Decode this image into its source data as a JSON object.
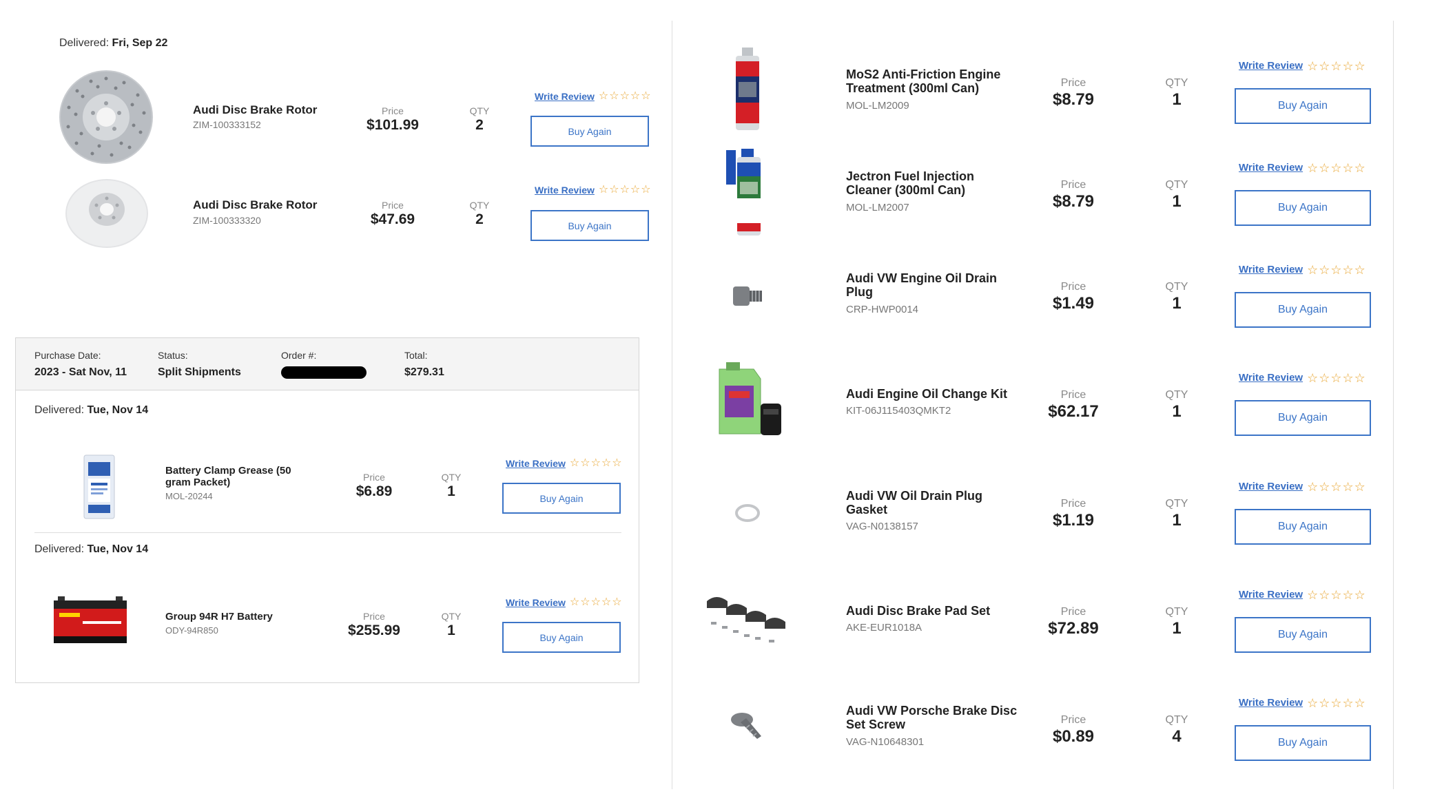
{
  "top_left": {
    "delivered_label": "Delivered:",
    "delivered_date": "Fri, Sep 22",
    "items": [
      {
        "name": "Audi Disc Brake Rotor",
        "sku": "ZIM-100333152",
        "price_label": "Price",
        "price": "$101.99",
        "qty_label": "QTY",
        "qty": "2",
        "review_label": "Write Review",
        "buy_label": "Buy Again",
        "image": "drilled-brake-rotor"
      },
      {
        "name": "Audi Disc Brake Rotor",
        "sku": "ZIM-100333320",
        "price_label": "Price",
        "price": "$47.69",
        "qty_label": "QTY",
        "qty": "2",
        "review_label": "Write Review",
        "buy_label": "Buy Again",
        "image": "solid-brake-rotor"
      }
    ]
  },
  "order": {
    "purchase_date_label": "Purchase Date:",
    "purchase_date": "2023 - Sat Nov, 11",
    "status_label": "Status:",
    "status": "Split Shipments",
    "order_label": "Order #:",
    "total_label": "Total:",
    "total": "$279.31",
    "shipments": [
      {
        "delivered_label": "Delivered:",
        "delivered_date": "Tue, Nov 14",
        "item": {
          "name": "Battery Clamp Grease (50 gram Packet)",
          "sku": "MOL-20244",
          "price_label": "Price",
          "price": "$6.89",
          "qty_label": "QTY",
          "qty": "1",
          "review_label": "Write Review",
          "buy_label": "Buy Again",
          "image": "grease-packet"
        }
      },
      {
        "delivered_label": "Delivered:",
        "delivered_date": "Tue, Nov 14",
        "item": {
          "name": "Group 94R H7 Battery",
          "sku": "ODY-94R850",
          "price_label": "Price",
          "price": "$255.99",
          "qty_label": "QTY",
          "qty": "1",
          "review_label": "Write Review",
          "buy_label": "Buy Again",
          "image": "car-battery"
        }
      }
    ]
  },
  "right": {
    "items": [
      {
        "name": "MoS2 Anti-Friction Engine Treatment (300ml Can)",
        "sku": "MOL-LM2009",
        "price_label": "Price",
        "price": "$8.79",
        "qty_label": "QTY",
        "qty": "1",
        "review_label": "Write Review",
        "buy_label": "Buy Again",
        "image": "additive-can"
      },
      {
        "name": "Jectron Fuel Injection Cleaner (300ml Can)",
        "sku": "MOL-LM2007",
        "price_label": "Price",
        "price": "$8.79",
        "qty_label": "QTY",
        "qty": "1",
        "review_label": "Write Review",
        "buy_label": "Buy Again",
        "image": "fuel-cleaner-can"
      },
      {
        "name": "Audi VW Engine Oil Drain Plug",
        "sku": "CRP-HWP0014",
        "price_label": "Price",
        "price": "$1.49",
        "qty_label": "QTY",
        "qty": "1",
        "review_label": "Write Review",
        "buy_label": "Buy Again",
        "image": "drain-plug"
      },
      {
        "name": "Audi Engine Oil Change Kit",
        "sku": "KIT-06J115403QMKT2",
        "price_label": "Price",
        "price": "$62.17",
        "qty_label": "QTY",
        "qty": "1",
        "review_label": "Write Review",
        "buy_label": "Buy Again",
        "image": "oil-jug-filter"
      },
      {
        "name": "Audi VW Oil Drain Plug Gasket",
        "sku": "VAG-N0138157",
        "price_label": "Price",
        "price": "$1.19",
        "qty_label": "QTY",
        "qty": "1",
        "review_label": "Write Review",
        "buy_label": "Buy Again",
        "image": "gasket-ring"
      },
      {
        "name": "Audi Disc Brake Pad Set",
        "sku": "AKE-EUR1018A",
        "price_label": "Price",
        "price": "$72.89",
        "qty_label": "QTY",
        "qty": "1",
        "review_label": "Write Review",
        "buy_label": "Buy Again",
        "image": "brake-pads"
      },
      {
        "name": "Audi VW Porsche Brake Disc Set Screw",
        "sku": "VAG-N10648301",
        "price_label": "Price",
        "price": "$0.89",
        "qty_label": "QTY",
        "qty": "4",
        "review_label": "Write Review",
        "buy_label": "Buy Again",
        "image": "set-screw"
      }
    ]
  },
  "colors": {
    "link": "#3a6fc4",
    "button_border": "#3b74c7",
    "star": "#e8a530"
  }
}
